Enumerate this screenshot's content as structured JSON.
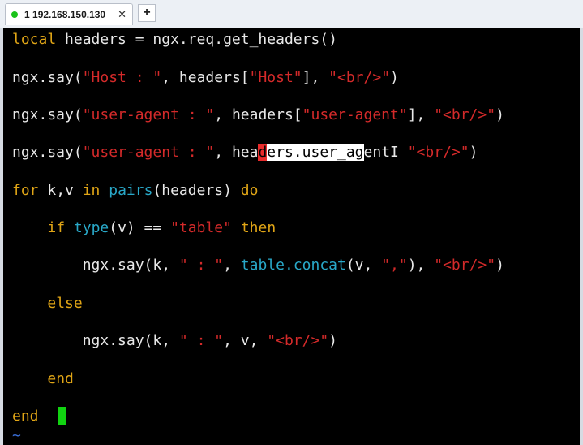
{
  "tab": {
    "number": "1",
    "title": " 192.168.150.130",
    "close": "✕",
    "status_color": "#19c219"
  },
  "new_tab_label": "+",
  "editor": {
    "line1": {
      "kw": "local",
      "rest": " headers = ngx.req.get_headers()"
    },
    "line2": {
      "a": "ngx.say(",
      "s1": "\"Host : \"",
      "b": ", headers[",
      "s2": "\"Host\"",
      "c": "], ",
      "s3": "\"<br/>\"",
      "d": ")"
    },
    "line3": {
      "a": "ngx.say(",
      "s1": "\"user-agent : \"",
      "b": ", headers[",
      "s2": "\"user-agent\"",
      "c": "], ",
      "s3": "\"<br/>\"",
      "d": ")"
    },
    "line4": {
      "a": "ngx.say(",
      "s1": "\"user-agent : \"",
      "b": ", hea",
      "cur": "d",
      "sel": "ers.user_ag",
      "c": "ent",
      "ibeam": "I",
      "d": " ",
      "s3": "\"<br/>\"",
      "e": ")"
    },
    "line5": {
      "kw1": "for",
      "a": " k,v ",
      "kw2": "in",
      "sp": " ",
      "fn": "pairs",
      "b": "(headers) ",
      "kw3": "do"
    },
    "line6": {
      "indent": "    ",
      "kw1": "if",
      "sp": " ",
      "fn": "type",
      "a": "(v) == ",
      "s1": "\"table\"",
      "sp2": " ",
      "kw2": "then"
    },
    "line7": {
      "indent": "        ",
      "a": "ngx.say(k, ",
      "s1": "\" : \"",
      "b": ", ",
      "fn": "table.concat",
      "c": "(v, ",
      "s2": "\",\"",
      "d": "), ",
      "s3": "\"<br/>\"",
      "e": ")"
    },
    "line8": {
      "indent": "    ",
      "kw": "else"
    },
    "line9": {
      "indent": "        ",
      "a": "ngx.say(k, ",
      "s1": "\" : \"",
      "b": ", v, ",
      "s2": "\"<br/>\"",
      "c": ")"
    },
    "line10": {
      "indent": "    ",
      "kw": "end"
    },
    "line11": {
      "kw": "end"
    },
    "tilde": "~"
  }
}
